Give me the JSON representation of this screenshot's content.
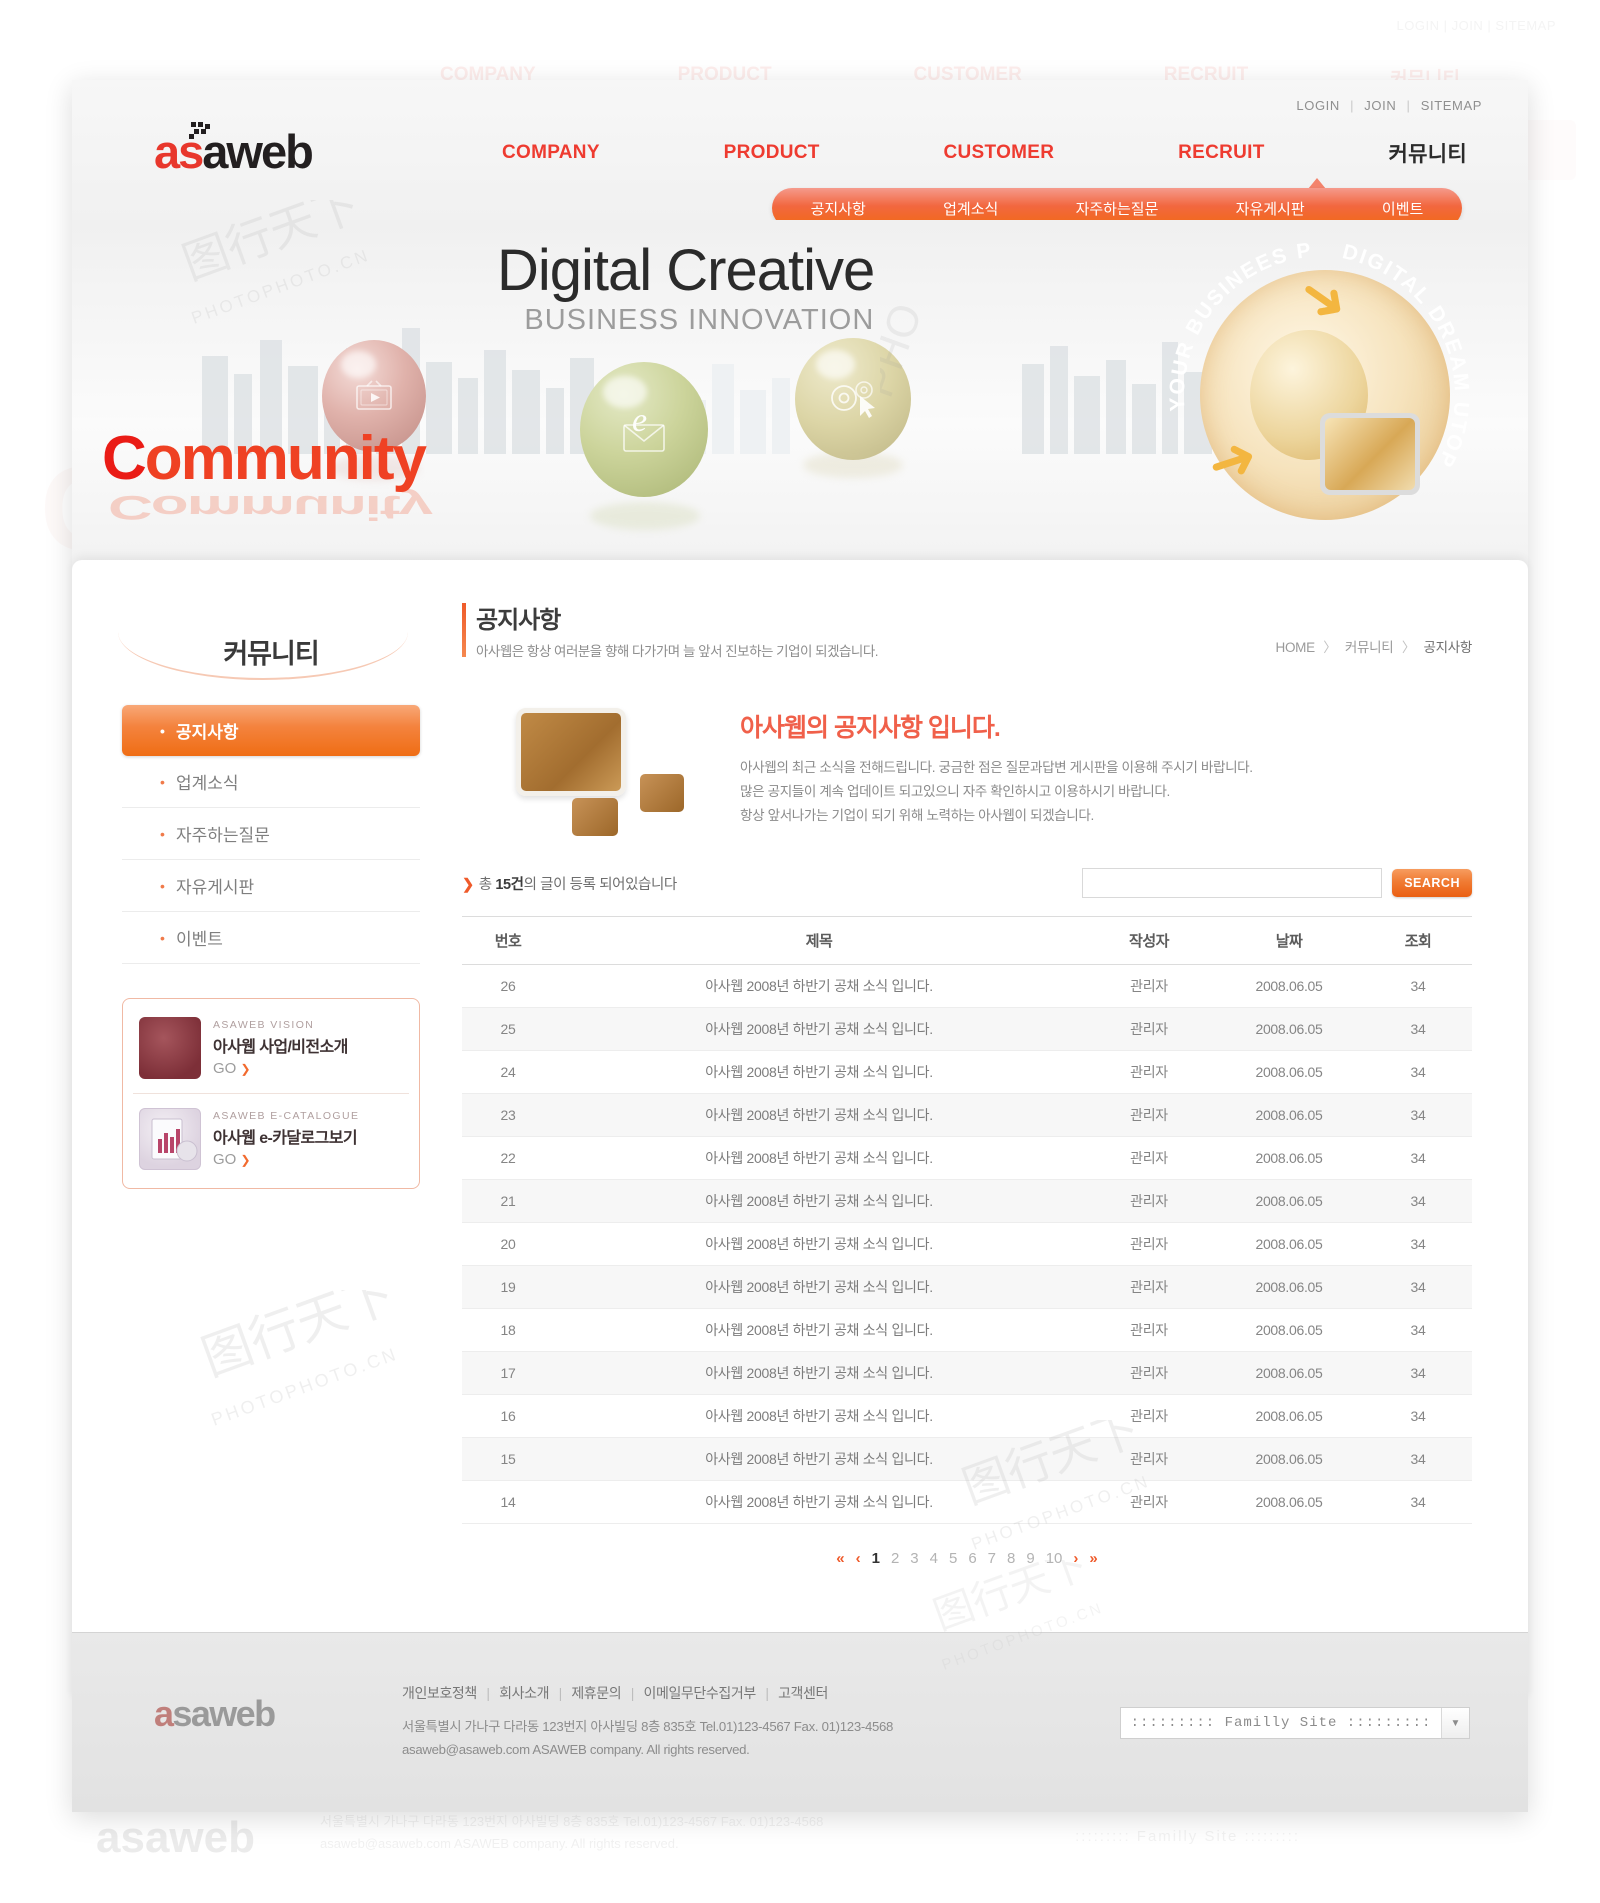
{
  "utility": {
    "login": "LOGIN",
    "join": "JOIN",
    "sitemap": "SITEMAP",
    "separator": "|"
  },
  "logo": {
    "a": "a",
    "s": "s",
    "rest": "aweb"
  },
  "mainnav": [
    {
      "label": "COMPANY"
    },
    {
      "label": "PRODUCT"
    },
    {
      "label": "CUSTOMER"
    },
    {
      "label": "RECRUIT"
    },
    {
      "label": "커뮤니티"
    }
  ],
  "subnav": [
    {
      "label": "공지사항"
    },
    {
      "label": "업계소식"
    },
    {
      "label": "자주하는질문"
    },
    {
      "label": "자유게시판"
    },
    {
      "label": "이벤트"
    }
  ],
  "hero": {
    "title_main": "Digital Creative",
    "title_sub": "BUSINESS INNOVATION",
    "badge_left_text": "YOUR BUSINEES PARTNER",
    "badge_right_text": "DIGITAL DREAM UTOPIA",
    "spheres": [
      {
        "icon": "play-icon"
      },
      {
        "icon": "email-icon"
      },
      {
        "icon": "gear-cursor-icon"
      }
    ]
  },
  "section_word": {
    "first": "C",
    "rest": "ommunity"
  },
  "sidebar": {
    "title": "커뮤니티",
    "items": [
      {
        "label": "공지사항",
        "active": true
      },
      {
        "label": "업계소식",
        "active": false
      },
      {
        "label": "자주하는질문",
        "active": false
      },
      {
        "label": "자유게시판",
        "active": false
      },
      {
        "label": "이벤트",
        "active": false
      }
    ],
    "banners": [
      {
        "kicker": "ASAWEB VISION",
        "title": "아사웹 사업/비전소개",
        "go": "GO",
        "arrow": "❯"
      },
      {
        "kicker": "ASAWEB E-CATALOGUE",
        "title": "아사웹 e-카달로그보기",
        "go": "GO",
        "arrow": "❯"
      }
    ]
  },
  "page": {
    "title": "공지사항",
    "subtitle": "아사웹은 항상 여러분을 향해  다가가며 늘 앞서 진보하는 기업이 되겠습니다.",
    "breadcrumb": {
      "home": "HOME",
      "level1": "커뮤니티",
      "level2": "공지사항",
      "sep": "〉"
    }
  },
  "intro": {
    "heading": "아사웹의 공지사항 입니다.",
    "lines": [
      "아사웹의 최근 소식을 전해드립니다. 궁금한 점은 질문과답변 게시판을 이용해 주시기 바랍니다.",
      "많은 공지들이 계속 업데이트 되고있으니 자주 확인하시고 이용하시기 바랍니다.",
      "항상 앞서나가는 기업이 되기 위해 노력하는 아사웹이 되겠습니다."
    ]
  },
  "list": {
    "total_prefix": "총 ",
    "total_count": "15건",
    "total_suffix": "의 글이 등록 되어있습니다",
    "arrow": "❯",
    "search_value": "",
    "search_placeholder": "",
    "search_button": "SEARCH",
    "columns": [
      "번호",
      "제목",
      "작성자",
      "날짜",
      "조회"
    ],
    "rows": [
      {
        "no": "26",
        "title": "아사웹 2008년 하반기 공채 소식 입니다.",
        "author": "관리자",
        "date": "2008.06.05",
        "hits": "34"
      },
      {
        "no": "25",
        "title": "아사웹 2008년 하반기 공채 소식 입니다.",
        "author": "관리자",
        "date": "2008.06.05",
        "hits": "34"
      },
      {
        "no": "24",
        "title": "아사웹 2008년 하반기 공채 소식 입니다.",
        "author": "관리자",
        "date": "2008.06.05",
        "hits": "34"
      },
      {
        "no": "23",
        "title": "아사웹 2008년 하반기 공채 소식 입니다.",
        "author": "관리자",
        "date": "2008.06.05",
        "hits": "34"
      },
      {
        "no": "22",
        "title": "아사웹 2008년 하반기 공채 소식 입니다.",
        "author": "관리자",
        "date": "2008.06.05",
        "hits": "34"
      },
      {
        "no": "21",
        "title": "아사웹 2008년 하반기 공채 소식 입니다.",
        "author": "관리자",
        "date": "2008.06.05",
        "hits": "34"
      },
      {
        "no": "20",
        "title": "아사웹 2008년 하반기 공채 소식 입니다.",
        "author": "관리자",
        "date": "2008.06.05",
        "hits": "34"
      },
      {
        "no": "19",
        "title": "아사웹 2008년 하반기 공채 소식 입니다.",
        "author": "관리자",
        "date": "2008.06.05",
        "hits": "34"
      },
      {
        "no": "18",
        "title": "아사웹 2008년 하반기 공채 소식 입니다.",
        "author": "관리자",
        "date": "2008.06.05",
        "hits": "34"
      },
      {
        "no": "17",
        "title": "아사웹 2008년 하반기 공채 소식 입니다.",
        "author": "관리자",
        "date": "2008.06.05",
        "hits": "34"
      },
      {
        "no": "16",
        "title": "아사웹 2008년 하반기 공채 소식 입니다.",
        "author": "관리자",
        "date": "2008.06.05",
        "hits": "34"
      },
      {
        "no": "15",
        "title": "아사웹 2008년 하반기 공채 소식 입니다.",
        "author": "관리자",
        "date": "2008.06.05",
        "hits": "34"
      },
      {
        "no": "14",
        "title": "아사웹 2008년 하반기 공채 소식 입니다.",
        "author": "관리자",
        "date": "2008.06.05",
        "hits": "34"
      }
    ]
  },
  "pagination": {
    "first": "«",
    "prev": "‹",
    "pages": [
      "1",
      "2",
      "3",
      "4",
      "5",
      "6",
      "7",
      "8",
      "9",
      "10"
    ],
    "current": "1",
    "next": "›",
    "last": "»"
  },
  "footer": {
    "logo": {
      "a": "a",
      "rest": "saweb"
    },
    "links": [
      "개인보호정책",
      "회사소개",
      "제휴문의",
      "이메일무단수집거부",
      "고객센터"
    ],
    "sep": "|",
    "address": "서울특별시 가나구 다라동 123번지 아사빌딩 8층 835호 Tel.01)123-4567 Fax. 01)123-4568",
    "copyright": "asaweb@asaweb.com ASAWEB company. All rights reserved.",
    "family_site": "::::::::: Familly Site :::::::::",
    "family_arrow": "▼"
  },
  "colors": {
    "accent_red": "#ee3b30",
    "accent_orange": "#ef6d14",
    "intro_heading": "#f0604a",
    "text_gray": "#8b8b8b"
  }
}
